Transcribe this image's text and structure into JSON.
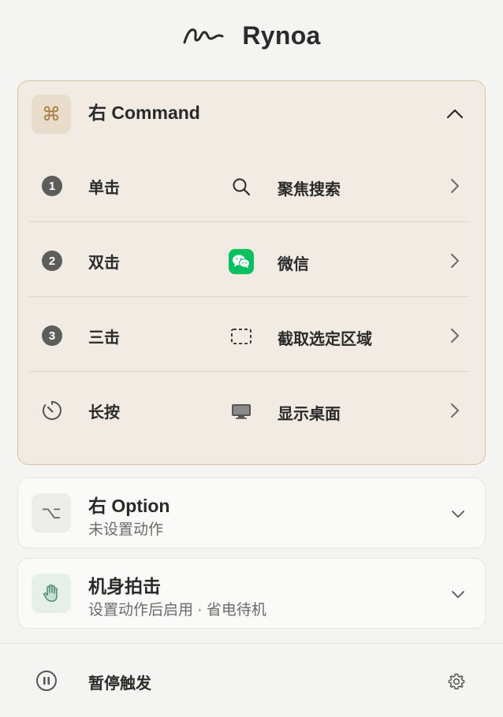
{
  "header": {
    "app_title": "Rynoa",
    "logo_icon": "signature-logo-icon"
  },
  "cards": [
    {
      "key_symbol": "⌘",
      "title": "右 Command",
      "expanded": true,
      "rows": [
        {
          "gesture_icon": "number-badge",
          "gesture_number": "1",
          "gesture_label": "单击",
          "action_icon": "search-icon",
          "action_label": "聚焦搜索"
        },
        {
          "gesture_icon": "number-badge",
          "gesture_number": "2",
          "gesture_label": "双击",
          "action_icon": "wechat-icon",
          "action_label": "微信"
        },
        {
          "gesture_icon": "number-badge",
          "gesture_number": "3",
          "gesture_label": "三击",
          "action_icon": "screenshot-region-icon",
          "action_label": "截取选定区域"
        },
        {
          "gesture_icon": "timer-icon",
          "gesture_label": "长按",
          "action_icon": "desktop-icon",
          "action_label": "显示桌面"
        }
      ]
    },
    {
      "key_symbol": "⌥",
      "title": "右 Option",
      "subtitle": "未设置动作",
      "expanded": false
    },
    {
      "key_symbol": "hand-icon",
      "title": "机身拍击",
      "subtitle": "设置动作后启用 · 省电待机",
      "expanded": false
    }
  ],
  "footer": {
    "pause_label": "暂停触发",
    "pause_icon": "pause-icon",
    "settings_icon": "gear-icon"
  },
  "colors": {
    "accent": "#a97c3f",
    "expanded_bg": "#f1ebe3",
    "expanded_border": "#d7c39e",
    "wechat_green": "#07c160"
  }
}
